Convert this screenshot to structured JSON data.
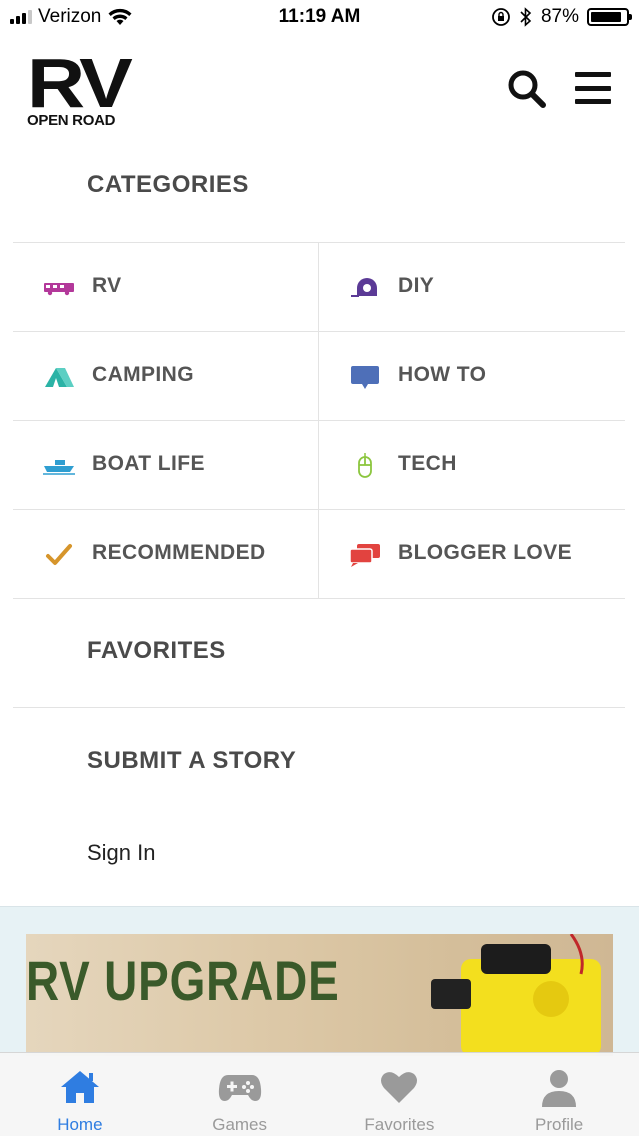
{
  "status_bar": {
    "carrier": "Verizon",
    "time": "11:19 AM",
    "battery": "87%",
    "battery_level": 0.87
  },
  "header": {
    "logo_main": "RV",
    "logo_sub": "OPEN ROAD"
  },
  "categories": {
    "title": "CATEGORIES",
    "items": [
      {
        "label": "RV",
        "icon": "rv-icon",
        "color": "#b3389a"
      },
      {
        "label": "DIY",
        "icon": "tape-measure-icon",
        "color": "#5b3a96"
      },
      {
        "label": "CAMPING",
        "icon": "tent-icon",
        "color": "#2bb3a6"
      },
      {
        "label": "HOW TO",
        "icon": "chat-bubble-icon",
        "color": "#4e6fb8"
      },
      {
        "label": "BOAT LIFE",
        "icon": "boat-icon",
        "color": "#2f9ed1"
      },
      {
        "label": "TECH",
        "icon": "mouse-icon",
        "color": "#8cc63f"
      },
      {
        "label": "RECOMMENDED",
        "icon": "checkmark-icon",
        "color": "#d6952b"
      },
      {
        "label": "BLOGGER LOVE",
        "icon": "chat-bubbles-icon",
        "color": "#e2433f"
      }
    ]
  },
  "favorites": {
    "title": "FAVORITES"
  },
  "submit": {
    "title": "SUBMIT A STORY"
  },
  "signin": {
    "label": "Sign In"
  },
  "ad": {
    "text": "RV UPGRADE"
  },
  "tabbar": {
    "active_color": "#2f7de1",
    "tabs": [
      {
        "label": "Home",
        "icon": "home-icon"
      },
      {
        "label": "Games",
        "icon": "gamepad-icon"
      },
      {
        "label": "Favorites",
        "icon": "heart-icon"
      },
      {
        "label": "Profile",
        "icon": "person-icon"
      }
    ]
  }
}
